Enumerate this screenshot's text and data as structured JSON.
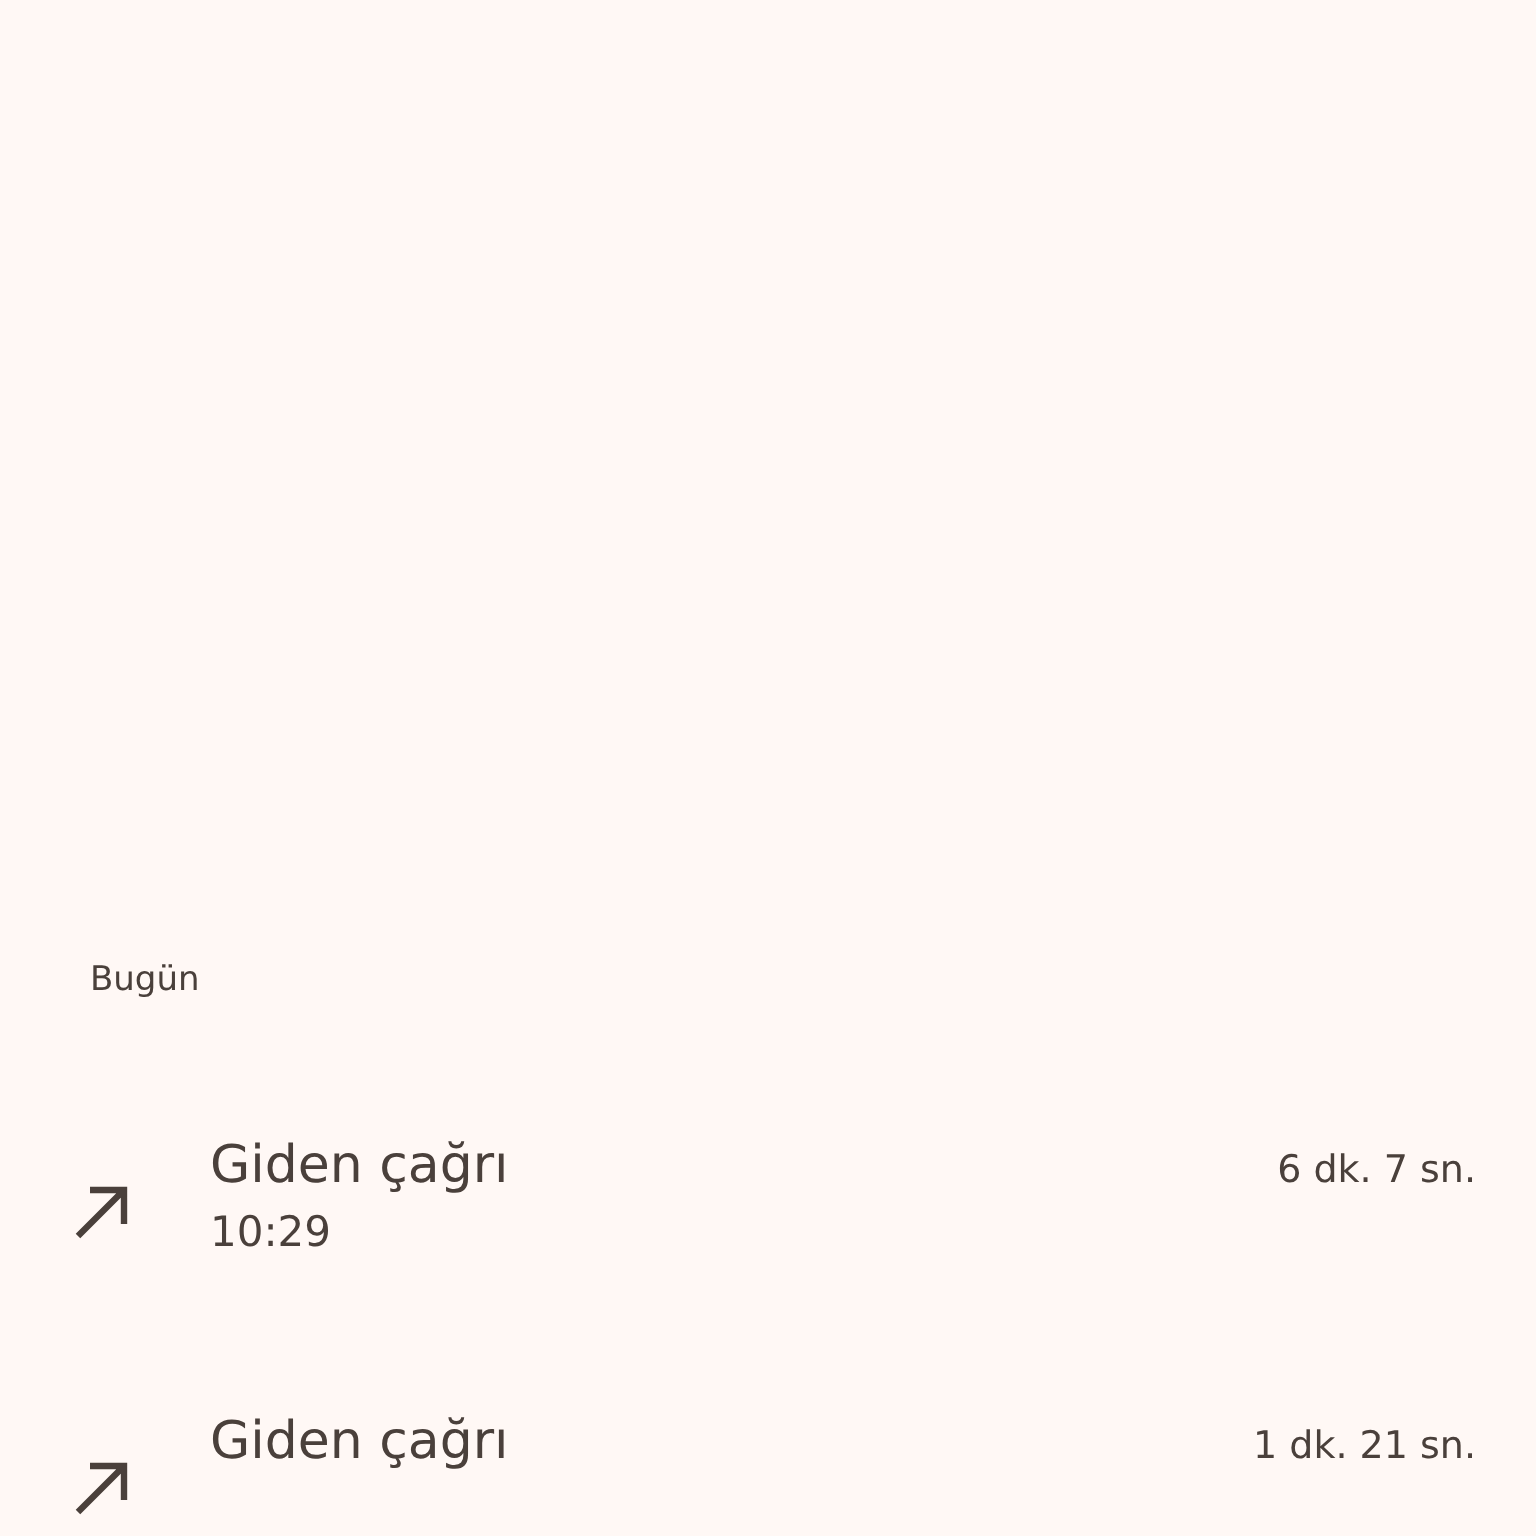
{
  "section_header": "Bugün",
  "calls": [
    {
      "kind": "outgoing",
      "title": "Giden çağrı",
      "time": "10:29",
      "duration": "6 dk. 7 sn."
    },
    {
      "kind": "outgoing",
      "title": "Giden çağrı",
      "duration": "1 dk. 21 sn."
    }
  ]
}
